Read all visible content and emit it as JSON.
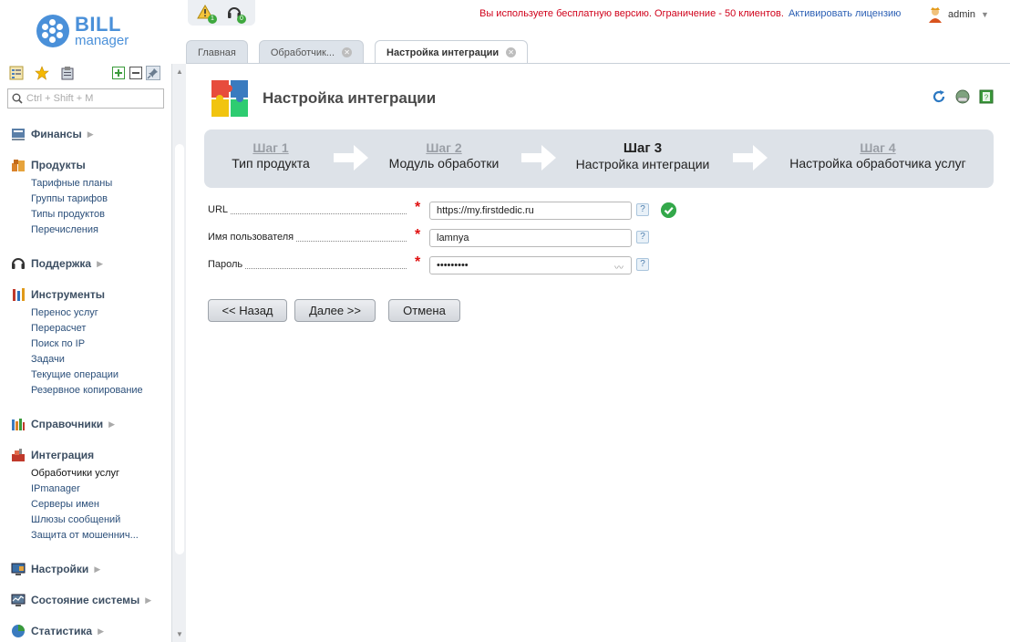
{
  "logo": {
    "bill": "BILL",
    "manager": "manager"
  },
  "notifications": {
    "alerts_count": "1",
    "support_count": "0"
  },
  "license": {
    "message": "Вы используете бесплатную версию. Ограничение - 50 клиентов.",
    "activate_link": "Активировать лицензию"
  },
  "user": {
    "name": "admin"
  },
  "tabs": [
    {
      "label": "Главная"
    },
    {
      "label": "Обработчик..."
    },
    {
      "label": "Настройка интеграции"
    }
  ],
  "search": {
    "placeholder": "Ctrl + Shift + M"
  },
  "sidebar": {
    "finance": "Финансы",
    "products": {
      "title": "Продукты",
      "items": [
        "Тарифные планы",
        "Группы тарифов",
        "Типы продуктов",
        "Перечисления"
      ]
    },
    "support": "Поддержка",
    "tools": {
      "title": "Инструменты",
      "items": [
        "Перенос услуг",
        "Перерасчет",
        "Поиск по IP",
        "Задачи",
        "Текущие операции",
        "Резервное копирование"
      ]
    },
    "references": "Справочники",
    "integration": {
      "title": "Интеграция",
      "items": [
        "Обработчики услуг",
        "IPmanager",
        "Серверы имен",
        "Шлюзы сообщений",
        "Защита от мошеннич..."
      ]
    },
    "settings": "Настройки",
    "system_status": "Состояние системы",
    "statistics": "Статистика"
  },
  "page": {
    "title": "Настройка интеграции"
  },
  "wizard": {
    "steps": [
      {
        "num": "Шаг 1",
        "label": "Тип продукта"
      },
      {
        "num": "Шаг 2",
        "label": "Модуль обработки"
      },
      {
        "num": "Шаг 3",
        "label": "Настройка интеграции"
      },
      {
        "num": "Шаг 4",
        "label": "Настройка обработчика услуг"
      }
    ],
    "active_step": 3
  },
  "form": {
    "url": {
      "label": "URL",
      "value": "https://my.firstdedic.ru"
    },
    "username": {
      "label": "Имя пользователя",
      "value": "lamnya"
    },
    "password": {
      "label": "Пароль",
      "value": "•••••••••"
    },
    "help_glyph": "?"
  },
  "buttons": {
    "back": "<< Назад",
    "next": "Далее >>",
    "cancel": "Отмена"
  },
  "colors": {
    "accent": "#4a90d9",
    "license_warning": "#d0021b",
    "required": "#e01010",
    "ok": "#33a84a"
  }
}
